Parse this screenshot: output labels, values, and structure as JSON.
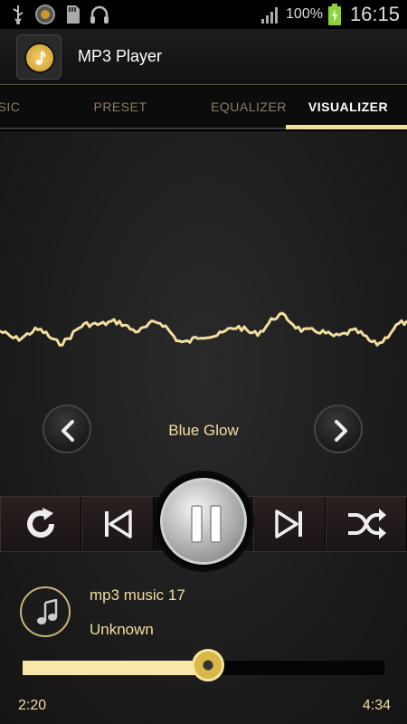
{
  "status_bar": {
    "icons": [
      "usb-icon",
      "app-notification-icon",
      "sd-card-icon",
      "headphones-icon"
    ],
    "signal": "signal-icon",
    "battery_percent": "100%",
    "battery_icon": "battery-charging-icon",
    "time": "16:15"
  },
  "app_bar": {
    "title": "MP3 Player",
    "logo_icon": "music-note-icon"
  },
  "tabs": [
    {
      "label": "MUSIC",
      "visible_text": "SIC"
    },
    {
      "label": "PRESET"
    },
    {
      "label": "EQUALIZER"
    },
    {
      "label": "VISUALIZER",
      "active": true
    }
  ],
  "visualizer": {
    "preset_name": "Blue Glow",
    "prev_icon": "chevron-left-icon",
    "next_icon": "chevron-right-icon"
  },
  "controls": {
    "repeat_icon": "repeat-icon",
    "previous_icon": "skip-previous-icon",
    "play_pause_icon": "pause-icon",
    "next_icon": "skip-next-icon",
    "shuffle_icon": "shuffle-icon"
  },
  "track": {
    "title": "mp3 music 17",
    "artist": "Unknown",
    "icon": "music-note-icon"
  },
  "progress": {
    "elapsed": "2:20",
    "total": "4:34",
    "fraction": 0.51
  },
  "colors": {
    "accent": "#f2dea0",
    "waveform": "#f2dea0",
    "background": "#1a1a1a"
  }
}
